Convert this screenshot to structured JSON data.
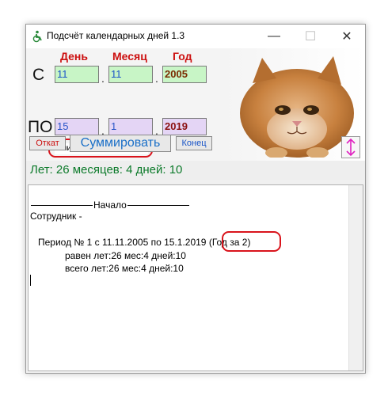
{
  "window": {
    "title": "Подсчёт календарных дней 1.3",
    "minimize": "—",
    "maximize": "☐",
    "close": "✕"
  },
  "headers": {
    "day": "День",
    "month": "Месяц",
    "year": "Год"
  },
  "from": {
    "label": "С",
    "day": "11",
    "month": "11",
    "year": "2005"
  },
  "to": {
    "label": "ПО",
    "day": "15",
    "month": "1",
    "year": "2019"
  },
  "separator": ".",
  "checkbox": {
    "label": "Считать год за 2"
  },
  "buttons": {
    "cancel": "Откат",
    "sum": "Суммировать",
    "end": "Конец"
  },
  "result": "Лет: 26   месяцев: 4   дней: 10",
  "output": {
    "start_label": "Начало",
    "employee": "Сотрудник -",
    "period": "Период № 1 с 11.11.2005 по 15.1.2019",
    "year_note": "(Год за 2)",
    "equal": "равен   лет:26   мес:4   дней:10",
    "total": "всего   лет:26   мес:4   дней:10"
  },
  "colors": {
    "header_red": "#cc1010",
    "field_green": "#c8f5c6",
    "field_purple": "#e4d5f5",
    "result_green": "#0c7a2a",
    "highlight_red": "#d9141c",
    "sum_blue": "#1a6fc8"
  }
}
